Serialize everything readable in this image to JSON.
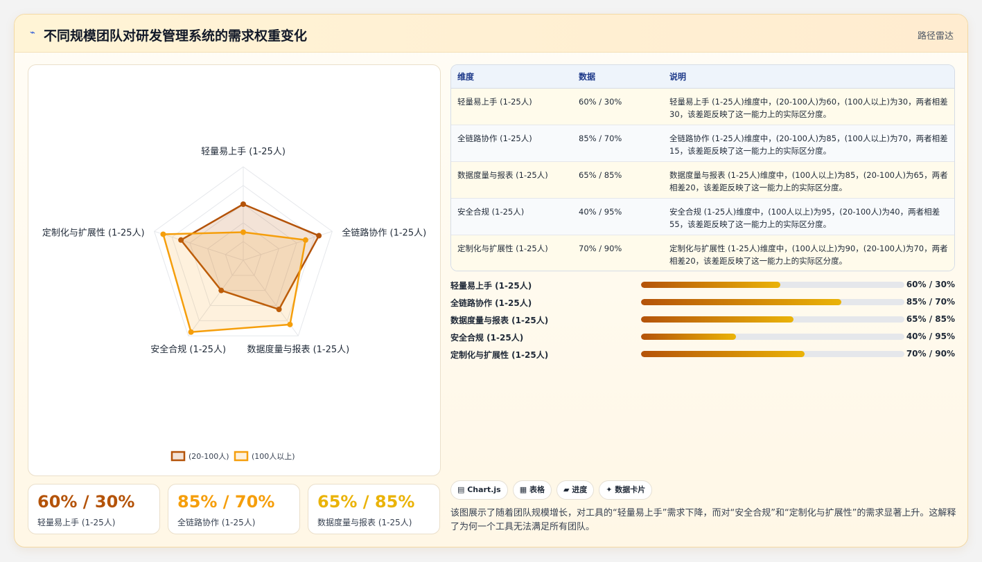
{
  "header": {
    "title": "不同规模团队对研发管理系统的需求权重变化",
    "tag": "路径雷达"
  },
  "chart_data": {
    "type": "radar",
    "axes": [
      "轻量易上手 (1-25人)",
      "全链路协作 (1-25人)",
      "数据度量与报表 (1-25人)",
      "安全合规 (1-25人)",
      "定制化与扩展性 (1-25人)"
    ],
    "rlim": [
      0,
      100
    ],
    "series": [
      {
        "name": "(20-100人)",
        "values": [
          60,
          85,
          65,
          40,
          70
        ],
        "color": "#b45309"
      },
      {
        "name": "(100人以上)",
        "values": [
          30,
          70,
          85,
          95,
          90
        ],
        "color": "#f59e0b"
      }
    ],
    "legend": "bottom"
  },
  "kpis": [
    {
      "value": "60% / 30%",
      "label": "轻量易上手 (1-25人)",
      "color": "#b45309"
    },
    {
      "value": "85% / 70%",
      "label": "全链路协作 (1-25人)",
      "color": "#f59e0b"
    },
    {
      "value": "65% / 85%",
      "label": "数据度量与报表 (1-25人)",
      "color": "#eab308"
    }
  ],
  "table": {
    "headers": [
      "维度",
      "数据",
      "说明"
    ],
    "rows": [
      {
        "dim": "轻量易上手 (1-25人)",
        "data": "60% / 30%",
        "desc": "轻量易上手 (1-25人)维度中，(20-100人)为60，(100人以上)为30，两者相差30，该差距反映了这一能力上的实际区分度。"
      },
      {
        "dim": "全链路协作 (1-25人)",
        "data": "85% / 70%",
        "desc": "全链路协作 (1-25人)维度中，(20-100人)为85，(100人以上)为70，两者相差15，该差距反映了这一能力上的实际区分度。"
      },
      {
        "dim": "数据度量与报表 (1-25人)",
        "data": "65% / 85%",
        "desc": "数据度量与报表 (1-25人)维度中，(100人以上)为85，(20-100人)为65，两者相差20，该差距反映了这一能力上的实际区分度。"
      },
      {
        "dim": "安全合规 (1-25人)",
        "data": "40% / 95%",
        "desc": "安全合规 (1-25人)维度中，(100人以上)为95，(20-100人)为40，两者相差55，该差距反映了这一能力上的实际区分度。"
      },
      {
        "dim": "定制化与扩展性 (1-25人)",
        "data": "70% / 90%",
        "desc": "定制化与扩展性 (1-25人)维度中，(100人以上)为90，(20-100人)为70，两者相差20，该差距反映了这一能力上的实际区分度。"
      }
    ]
  },
  "progress": [
    {
      "label": "轻量易上手 (1-25人)",
      "percent": 53,
      "value": "60% / 30%"
    },
    {
      "label": "全链路协作 (1-25人)",
      "percent": 76,
      "value": "85% / 70%"
    },
    {
      "label": "数据度量与报表 (1-25人)",
      "percent": 58,
      "value": "65% / 85%"
    },
    {
      "label": "安全合规 (1-25人)",
      "percent": 36,
      "value": "40% / 95%"
    },
    {
      "label": "定制化与扩展性 (1-25人)",
      "percent": 62,
      "value": "70% / 90%"
    }
  ],
  "pills": [
    "▤ Chart.js",
    "▦ 表格",
    "▰ 进度",
    "✦ 数据卡片"
  ],
  "summary": "该图展示了随着团队规模增长，对工具的“轻量易上手”需求下降，而对“安全合规”和“定制化与扩展性”的需求显著上升。这解释了为何一个工具无法满足所有团队。"
}
